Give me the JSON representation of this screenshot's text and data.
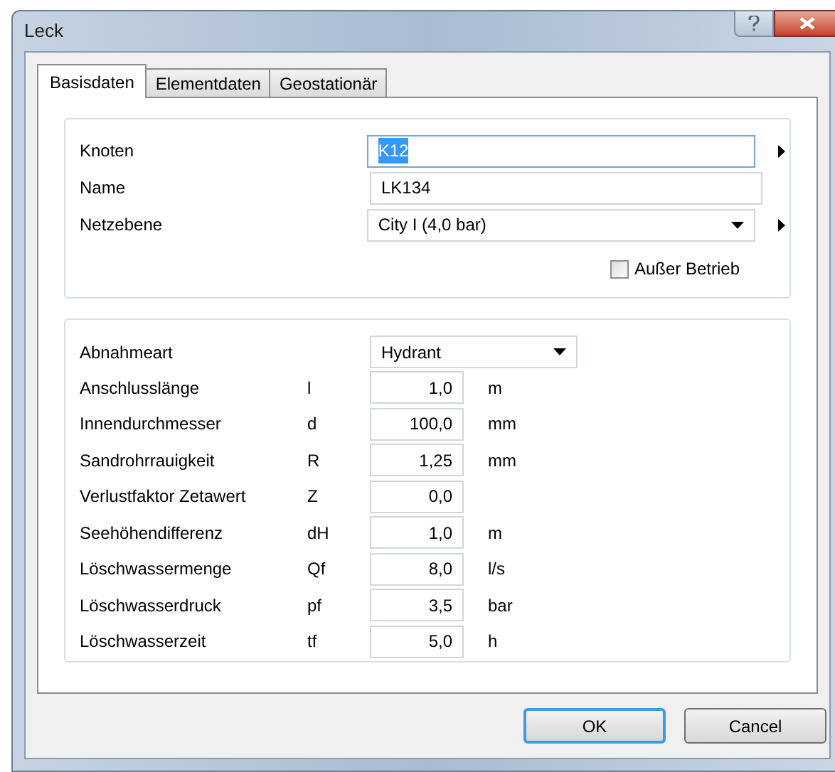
{
  "window": {
    "title": "Leck"
  },
  "tabs": [
    {
      "label": "Basisdaten",
      "selected": true
    },
    {
      "label": "Elementdaten",
      "selected": false
    },
    {
      "label": "Geostationär",
      "selected": false
    }
  ],
  "general": {
    "fields": [
      {
        "label": "Knoten",
        "kind": "text",
        "value": "K12",
        "text_selected": true,
        "has_arrow": true
      },
      {
        "label": "Name",
        "kind": "text",
        "value": "LK134",
        "text_selected": false,
        "has_arrow": false
      },
      {
        "label": "Netzebene",
        "kind": "combo",
        "value": "City I (4,0 bar)",
        "text_selected": false,
        "has_arrow": true
      }
    ],
    "out_of_service": {
      "label": "Außer Betrieb",
      "checked": false
    }
  },
  "withdrawal": {
    "type": {
      "label": "Abnahmeart",
      "value": "Hydrant"
    },
    "params": [
      {
        "label": "Anschlusslänge",
        "symbol": "l",
        "value": "1,0",
        "unit": "m"
      },
      {
        "label": "Innendurchmesser",
        "symbol": "d",
        "value": "100,0",
        "unit": "mm"
      },
      {
        "label": "Sandrohrrauigkeit",
        "symbol": "R",
        "value": "1,25",
        "unit": "mm"
      },
      {
        "label": "Verlustfaktor Zetawert",
        "symbol": "Z",
        "value": "0,0"
      },
      {
        "label": "Seehöhendifferenz",
        "symbol": "dH",
        "value": "1,0",
        "unit": "m"
      },
      {
        "label": "Löschwassermenge",
        "symbol": "Qf",
        "value": "8,0",
        "unit": "l/s"
      },
      {
        "label": "Löschwasserdruck",
        "symbol": "pf",
        "value": "3,5",
        "unit": "bar"
      },
      {
        "label": "Löschwasserzeit",
        "symbol": "tf",
        "value": "5,0",
        "unit": "h"
      }
    ]
  },
  "buttons": [
    {
      "label": "OK",
      "default": true
    },
    {
      "label": "Cancel",
      "default": false
    }
  ]
}
